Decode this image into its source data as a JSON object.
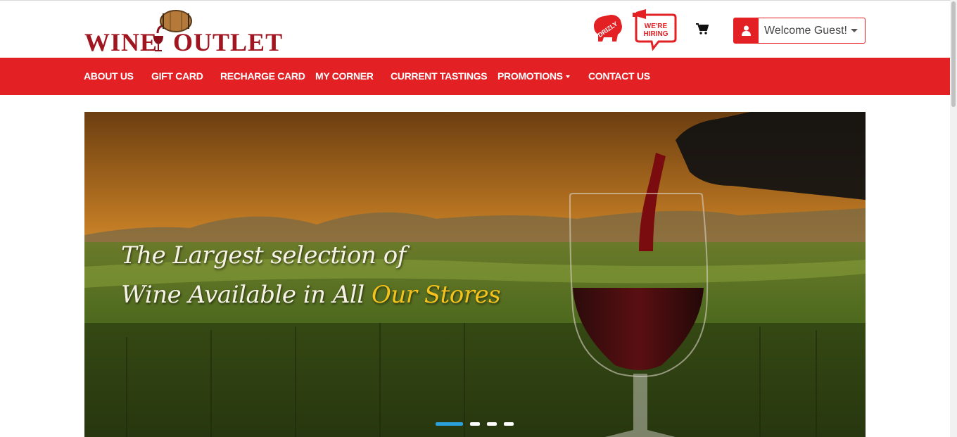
{
  "logo": {
    "part1": "WINE",
    "part2": "OUTLET"
  },
  "badges": {
    "drizly": "DRIZLY",
    "hiring_line1": "WE'RE",
    "hiring_line2": "HIRING"
  },
  "header": {
    "cart_icon": "cart-icon",
    "user_icon": "user-icon",
    "welcome_label": "Welcome Guest!"
  },
  "nav": {
    "items": [
      {
        "label": "ABOUT US"
      },
      {
        "label": "GIFT CARD"
      },
      {
        "label": "RECHARGE CARD"
      },
      {
        "label": "MY CORNER"
      },
      {
        "label": "CURRENT TASTINGS"
      },
      {
        "label": "PROMOTIONS"
      },
      {
        "label": "CONTACT US"
      }
    ]
  },
  "hero": {
    "line1": "The Largest selection of",
    "line2_a": "Wine Available in All ",
    "line2_b": "Our Stores"
  },
  "carousel": {
    "slides": 4,
    "active": 1
  },
  "colors": {
    "brand_red": "#e32124",
    "logo_red": "#a0151f",
    "highlight": "#f5c31b",
    "active_dot": "#2aa1da"
  }
}
